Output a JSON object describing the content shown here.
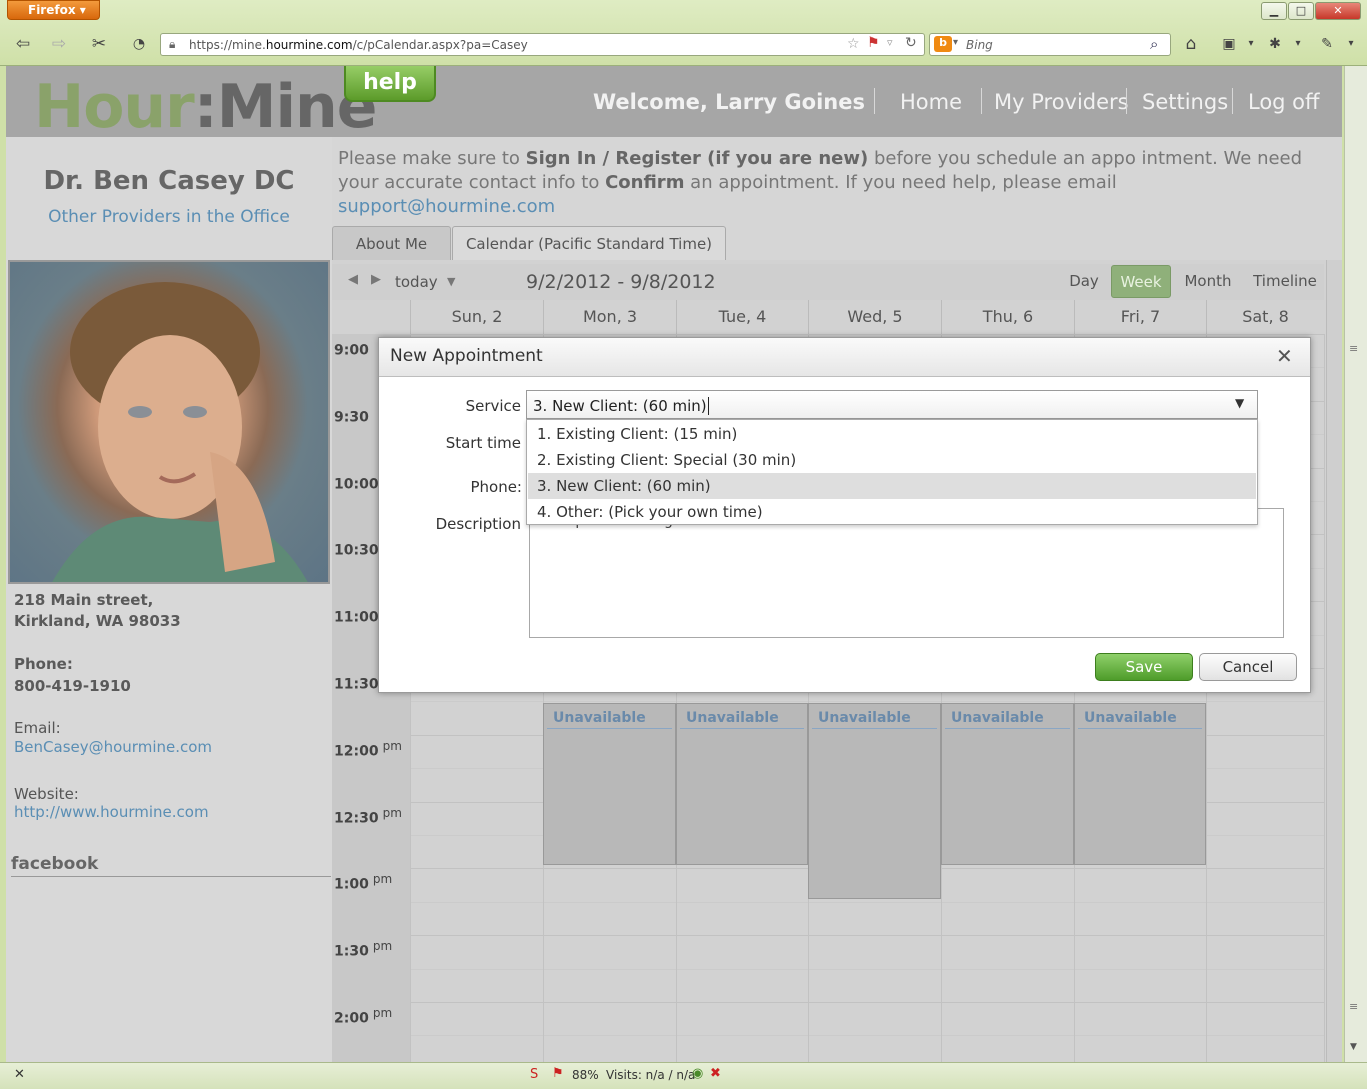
{
  "browser": {
    "app_button": "Firefox",
    "url_prefix": "https://mine.",
    "url_domain": "hourmine.com",
    "url_path": "/c/pCalendar.aspx?pa=Casey",
    "search_engine_placeholder": "Bing"
  },
  "header": {
    "logo_part1": "Hour",
    "logo_part2": ":Mine",
    "help_label": "help",
    "welcome": "Welcome, Larry Goines",
    "nav": [
      "Home",
      "My Providers",
      "Settings",
      "Log off"
    ]
  },
  "provider": {
    "name": "Dr. Ben Casey DC",
    "other_providers": "Other Providers in the Office",
    "address_line1": "218 Main street,",
    "address_line2": "Kirkland, WA 98033",
    "phone_label": "Phone:",
    "phone": "800-419-1910",
    "email_label": "Email:",
    "email": "BenCasey@hourmine.com",
    "website_label": "Website:",
    "website": "http://www.hourmine.com",
    "facebook": "facebook"
  },
  "notice": {
    "t1": "Please make sure to ",
    "b1": "Sign In / Register (if you are new)",
    "t2": " before you schedule an appo intment. We need your accurate contact info to ",
    "b2": "Confirm",
    "t3": " an appointment. If you need help, please email ",
    "link": "support@hourmine.com"
  },
  "tabs": [
    "About Me",
    "Calendar (Pacific Standard Time)"
  ],
  "calendar": {
    "today_label": "today",
    "date_range": "9/2/2012 - 9/8/2012",
    "views": [
      "Day",
      "Week",
      "Month",
      "Timeline"
    ],
    "active_view": "Week",
    "days": [
      "Sun, 2",
      "Mon, 3",
      "Tue, 4",
      "Wed, 5",
      "Thu, 6",
      "Fri, 7",
      "Sat, 8"
    ],
    "times": [
      {
        "t": "9:00",
        "ampm": ""
      },
      {
        "t": "9:30",
        "ampm": ""
      },
      {
        "t": "10:00",
        "ampm": ""
      },
      {
        "t": "10:30",
        "ampm": ""
      },
      {
        "t": "11:00",
        "ampm": ""
      },
      {
        "t": "11:30",
        "ampm": ""
      },
      {
        "t": "12:00",
        "ampm": "pm"
      },
      {
        "t": "12:30",
        "ampm": "pm"
      },
      {
        "t": "1:00",
        "ampm": "pm"
      },
      {
        "t": "1:30",
        "ampm": "pm"
      },
      {
        "t": "2:00",
        "ampm": "pm"
      }
    ],
    "unavailable_label": "Unavailable"
  },
  "modal": {
    "title": "New Appointment",
    "service_label": "Service",
    "service_value": "3. New Client: (60 min)",
    "start_time_label": "Start time",
    "phone_label": "Phone:",
    "description_label": "Description",
    "description_value": "Neck pain radiating out to back",
    "options": [
      "1. Existing Client: (15 min)",
      "2. Existing Client: Special (30 min)",
      "3. New Client: (60 min)",
      "4. Other: (Pick your own time)"
    ],
    "selected_option_index": 2,
    "save_label": "Save",
    "cancel_label": "Cancel"
  },
  "status_bar": {
    "zoom": "88%",
    "visits": "Visits: n/a / n/a"
  },
  "colors": {
    "accent_green": "#5c9b2a",
    "link_blue": "#5a8eb4",
    "header_gray": "#a6a6a6"
  }
}
